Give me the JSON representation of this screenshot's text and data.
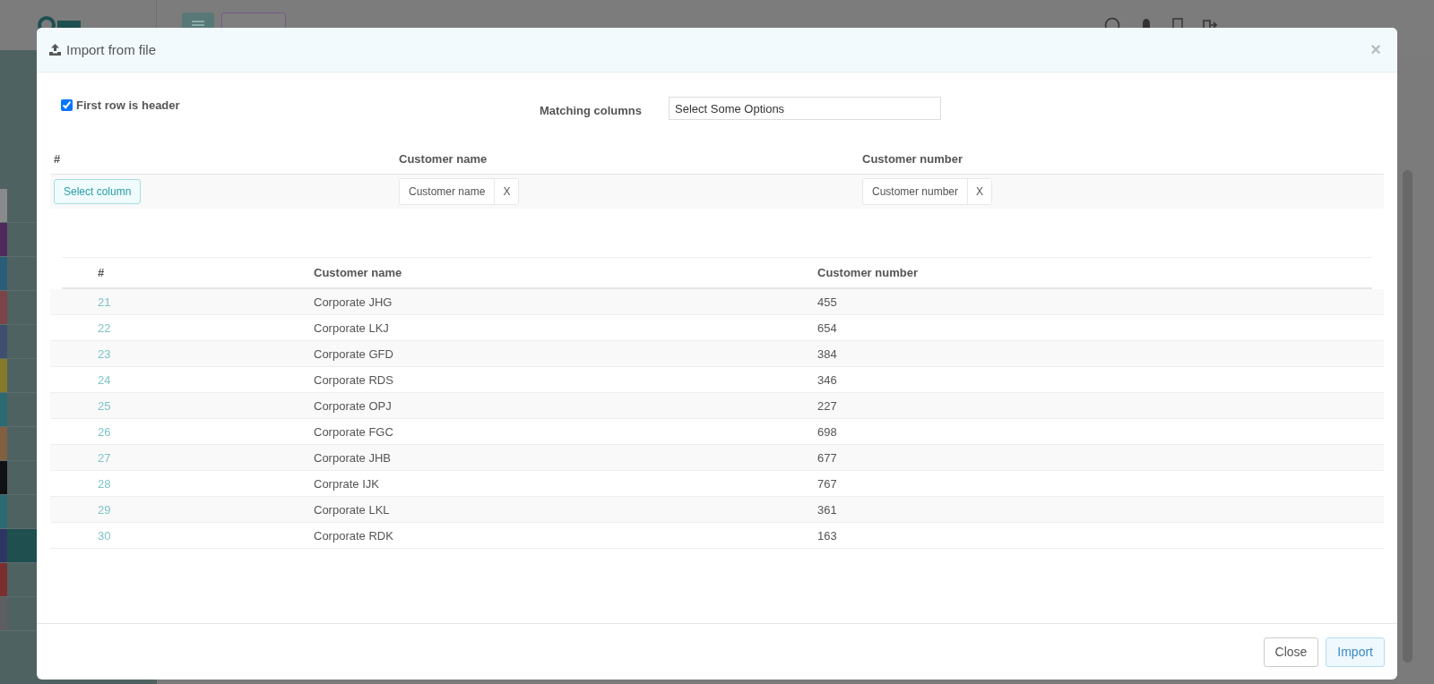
{
  "background": {
    "sidebar": {
      "items": [
        {
          "color": "#8a8a8a",
          "selected": false
        },
        {
          "color": "#4d2a5a",
          "selected": false
        },
        {
          "color": "#2a5d78",
          "selected": false
        },
        {
          "color": "#7a4448",
          "selected": false
        },
        {
          "color": "#3f4f6e",
          "selected": false
        },
        {
          "color": "#857a2a",
          "selected": false
        },
        {
          "color": "#2b6a72",
          "selected": false
        },
        {
          "color": "#80603f",
          "selected": false
        },
        {
          "color": "#111111",
          "selected": false
        },
        {
          "color": "#2b6a72",
          "selected": false
        },
        {
          "color": "#2d3563",
          "selected": true
        },
        {
          "color": "#7a2e2e",
          "selected": false
        },
        {
          "color": "#5e5e5e",
          "selected": false
        }
      ]
    }
  },
  "modal": {
    "title": "Import from file",
    "close": "×",
    "first_row_header": {
      "label": "First row is header",
      "checked": true
    },
    "matching": {
      "label": "Matching columns",
      "placeholder": "Select Some Options"
    },
    "mapping": {
      "columns": [
        "#",
        "Customer name",
        "Customer number"
      ],
      "select_button": "Select column",
      "chips": [
        {
          "label": "Customer name",
          "remove": "X"
        },
        {
          "label": "Customer number",
          "remove": "X"
        }
      ]
    },
    "preview": {
      "columns": [
        "#",
        "Customer name",
        "Customer number"
      ],
      "rows": [
        [
          "21",
          "Corporate JHG",
          "455"
        ],
        [
          "22",
          "Corporate LKJ",
          "654"
        ],
        [
          "23",
          "Corporate GFD",
          "384"
        ],
        [
          "24",
          "Corporate RDS",
          "346"
        ],
        [
          "25",
          "Corporate OPJ",
          "227"
        ],
        [
          "26",
          "Corporate FGC",
          "698"
        ],
        [
          "27",
          "Corporate JHB",
          "677"
        ],
        [
          "28",
          "Corprate IJK",
          "767"
        ],
        [
          "29",
          "Corporate LKL",
          "361"
        ],
        [
          "30",
          "Corporate RDK",
          "163"
        ]
      ]
    },
    "buttons": [
      {
        "label": "Close",
        "kind": "default"
      },
      {
        "label": "Import",
        "kind": "primary"
      }
    ]
  }
}
